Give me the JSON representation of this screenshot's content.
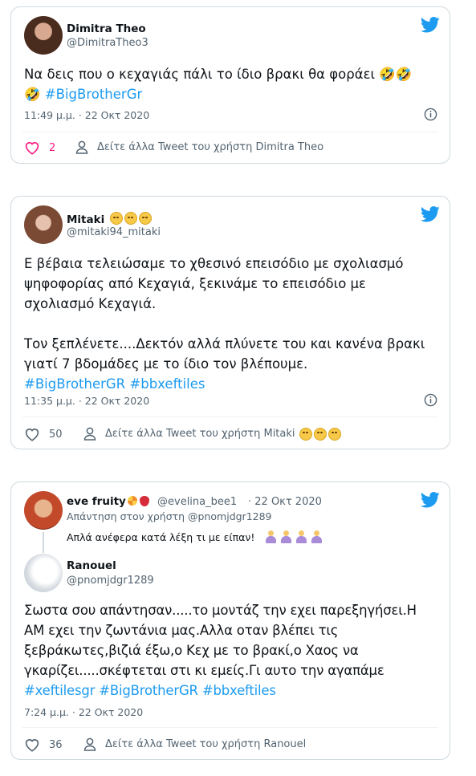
{
  "tweets": [
    {
      "name": "Dimitra Theo",
      "handle": "@DimitraTheo3",
      "body": "Να δεις που ο κεχαγιάς πάλι το ίδιο βρακι θα φοράει",
      "hashtag": "#BigBrotherGr",
      "time": "11:49 μ.μ. · 22 Οκτ 2020",
      "likes": "2",
      "see_more": "Δείτε άλλα Tweet του χρήστη Dimitra Theo"
    },
    {
      "name": "Mitaki",
      "handle": "@mitaki94_mitaki",
      "body_lines": [
        "Ε βέβαια τελειώσαμε το χθεσινό επεισόδιο με σχολιασμό",
        "ψηφοφορίας από Κεχαγιά, ξεκινάμε το επεισόδιο με",
        "σχολιασμό Κεχαγιά.",
        "Τον ξεπλένετε....Δεκτόν αλλά πλύνετε του και κανένα βρακι",
        "γιατί 7 βδομάδες με το ίδιο τον βλέπουμε."
      ],
      "hashtags": [
        "#BigBrotherGR",
        "#bbxeftiles"
      ],
      "time": "11:35 μ.μ. · 22 Οκτ 2020",
      "likes": "50",
      "see_more": "Δείτε άλλα Tweet του χρήστη Mitaki"
    },
    {
      "quoted": {
        "name": "eve fruity",
        "handle": "@evelina_bee1",
        "date": "· 22 Οκτ 2020",
        "reply_to": "Απάντηση στον χρήστη @pnomjdgr1289",
        "body": "Απλά ανέφερα κατά λέξη τι με είπαν!"
      },
      "name": "Ranouel",
      "handle": "@pnomjdgr1289",
      "body_lines": [
        "Σωστα σου απάντησαν.....το μοντάζ την εχει παρεξηγήσει.Η",
        "ΑΜ εχει την ζωντάνια μας.Αλλα οταν βλέπει τις",
        "ξεβράκωτες,βιζιά έξω,ο Κεχ με το βρακί,ο Χαος να",
        "γκαρίζει.....σκέφτεται στι κι εμείς.Γι αυτο την αγαπάμε"
      ],
      "hashtags": [
        "#xeftilesgr",
        "#BigBrotherGR",
        "#bbxeftiles"
      ],
      "time": "7:24 μ.μ. · 22 Οκτ 2020",
      "likes": "36",
      "see_more": "Δείτε άλλα Tweet του χρήστη Ranouel"
    }
  ]
}
